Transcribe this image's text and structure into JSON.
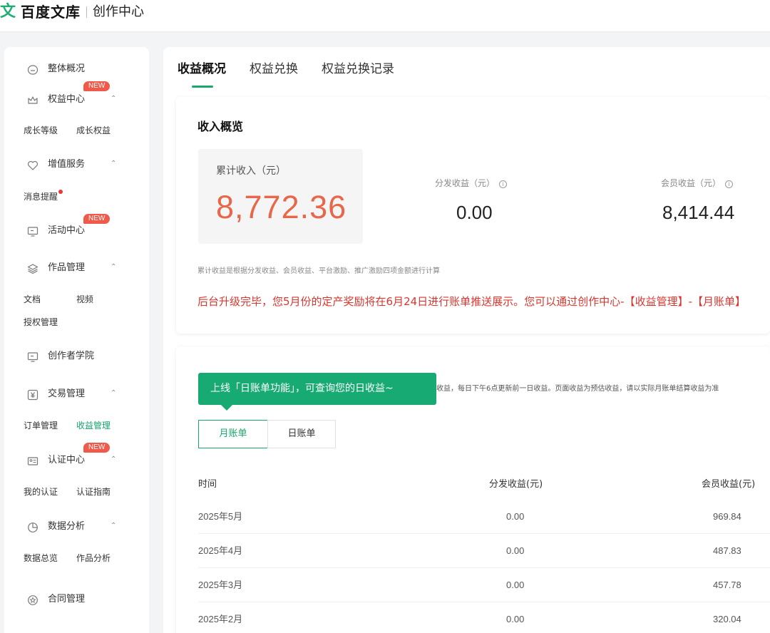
{
  "header": {
    "logo_glyph": "文",
    "logo_text": "百度文库",
    "section_title": "创作中心"
  },
  "sidebar": {
    "overview": "整体概况",
    "rights_center": "权益中心",
    "growth_level": "成长等级",
    "growth_rights": "成长权益",
    "value_added": "增值服务",
    "message_alert": "消息提醒",
    "activity_center": "活动中心",
    "works_mgmt": "作品管理",
    "docs": "文档",
    "video": "视频",
    "license_mgmt": "授权管理",
    "creator_academy": "创作者学院",
    "trade_mgmt": "交易管理",
    "order_mgmt": "订单管理",
    "income_mgmt": "收益管理",
    "cert_center": "认证中心",
    "my_cert": "我的认证",
    "cert_guide": "认证指南",
    "data_analysis": "数据分析",
    "data_overview": "数据总览",
    "works_analysis": "作品分析",
    "contract_mgmt": "合同管理",
    "new_badge": "NEW"
  },
  "tabs": [
    "收益概况",
    "权益兑换",
    "权益兑换记录"
  ],
  "income": {
    "title": "收入概览",
    "total_label": "累计收入（元）",
    "total_value": "8,772.36",
    "distribution_label": "分发收益（元）",
    "distribution_value": "0.00",
    "member_label": "会员收益（元）",
    "member_value": "8,414.44",
    "note": "累计收益是根据分发收益、会员收益、平台激励、推广激励四项金额进行计算",
    "alert": "后台升级完毕，您5月份的定产奖励将在6月24日进行账单推送展示。您可以通过创作中心-【收益管理】-【月账单】"
  },
  "bills": {
    "tooltip": "上线「日账单功能」，可查询您的日收益~",
    "note": "收益，每日下午6点更新前一日收益。页面收益为预估收益，请以实际月账单结算收益为准",
    "monthly": "月账单",
    "daily": "日账单",
    "columns": [
      "时间",
      "分发收益(元)",
      "会员收益(元)"
    ],
    "rows": [
      {
        "month": "2025年5月",
        "distribution": "0.00",
        "member": "969.84"
      },
      {
        "month": "2025年4月",
        "distribution": "0.00",
        "member": "487.83"
      },
      {
        "month": "2025年3月",
        "distribution": "0.00",
        "member": "457.78"
      },
      {
        "month": "2025年2月",
        "distribution": "0.00",
        "member": "320.04"
      }
    ]
  },
  "colors": {
    "brand_green": "#17ab73",
    "accent_red": "#e8674a",
    "alert_red": "#d9362f"
  }
}
